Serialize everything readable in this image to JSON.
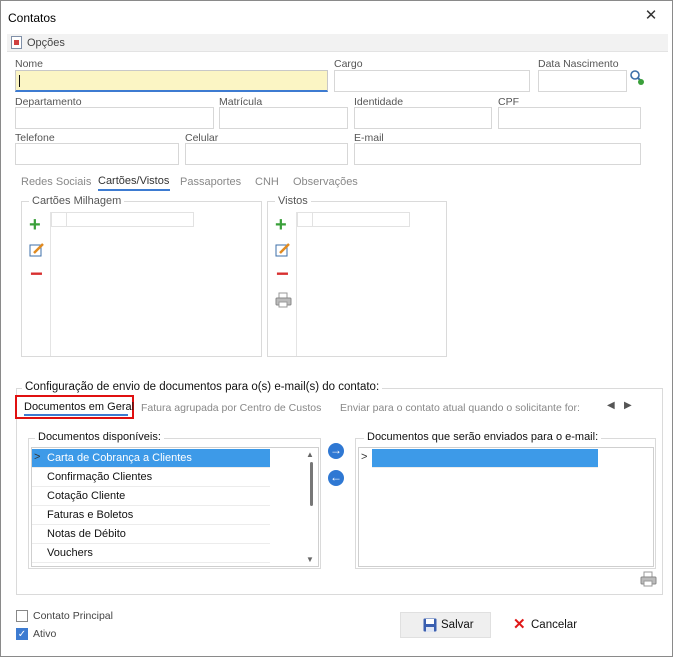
{
  "window": {
    "title": "Contatos",
    "close_glyph": "✕"
  },
  "options_bar": {
    "label": "Opções",
    "icon": "document-icon"
  },
  "fields": {
    "nome": {
      "label": "Nome",
      "value": ""
    },
    "cargo": {
      "label": "Cargo",
      "value": ""
    },
    "data_nascimento": {
      "label": "Data Nascimento",
      "value": ""
    },
    "departamento": {
      "label": "Departamento",
      "value": ""
    },
    "matricula": {
      "label": "Matrícula",
      "value": ""
    },
    "identidade": {
      "label": "Identidade",
      "value": ""
    },
    "cpf": {
      "label": "CPF",
      "value": ""
    },
    "telefone": {
      "label": "Telefone",
      "value": ""
    },
    "celular": {
      "label": "Celular",
      "value": ""
    },
    "email": {
      "label": "E-mail",
      "value": ""
    }
  },
  "tabs": [
    "Redes Sociais",
    "Cartões/Vistos",
    "Passaportes",
    "CNH",
    "Observações"
  ],
  "selected_tab": "Cartões/Vistos",
  "cartoes": {
    "title": "Cartões Milhagem"
  },
  "vistos": {
    "title": "Vistos"
  },
  "config": {
    "title": "Configuração de envio de documentos para o(s) e-mail(s) do contato:",
    "subtabs": [
      "Documentos em Geral",
      "Fatura agrupada por Centro de Custos",
      "Enviar para o contato atual quando o solicitante for:"
    ],
    "available_title": "Documentos disponíveis:",
    "available": [
      "Carta de Cobrança a Clientes",
      "Confirmação Clientes",
      "Cotação Cliente",
      "Faturas e Boletos",
      "Notas de Débito",
      "Vouchers"
    ],
    "selected_title": "Documentos que serão enviados para o e-mail:",
    "selected": [
      ""
    ]
  },
  "checkboxes": {
    "contato_principal": {
      "label": "Contato Principal",
      "checked": false
    },
    "ativo": {
      "label": "Ativo",
      "checked": true
    }
  },
  "buttons": {
    "salvar": "Salvar",
    "cancelar": "Cancelar"
  },
  "colors": {
    "accent": "#3d7bd1",
    "selection": "#3d9ae8",
    "highlight_box": "#e01010",
    "active_field": "#fbf5c4"
  }
}
